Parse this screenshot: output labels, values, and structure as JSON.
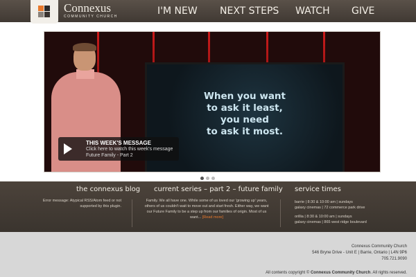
{
  "header": {
    "brand_name": "Connexus",
    "brand_sub": "COMMUNITY CHURCH",
    "logo_colors": [
      "#e8792c",
      "#2b2b2b",
      "#8a837c",
      "#d9d4cd"
    ],
    "nav": [
      "I'M NEW",
      "NEXT STEPS",
      "WATCH",
      "GIVE"
    ]
  },
  "hero": {
    "slide_text": [
      "When you want",
      "to ask it least,",
      "you need",
      "to ask it most."
    ],
    "message_title": "THIS WEEK'S MESSAGE",
    "message_line1": "Click here to watch this week's message",
    "message_line2": "Future Family - Part 2",
    "play_icon": "play-icon",
    "carousel_dots": 3,
    "active_dot": 1
  },
  "blog": {
    "title": "the connexus blog",
    "text_line1": "Error message: Atypical RSS/Atom feed or not",
    "text_line2": "supported by this plugin."
  },
  "series": {
    "title": "current series – part 2 – future family",
    "lines": [
      "Family. We all have one. While some of us loved our 'growing up' years,",
      "others of us couldn't wait to move out and start fresh. Either way, we want",
      "our Future Family to be a step up from our families of origin. Most of us"
    ],
    "last_line": "want...",
    "read_more": "[Read more]"
  },
  "service_times": {
    "title": "service times",
    "lines": [
      "barrie | 8:30 & 10:00 am | sundays",
      "galaxy cinemas | 72 commerce park drive",
      "orillia | 8:30 & 10:00 am | sundays",
      "galaxy cinemas | 865 west ridge boulevard"
    ]
  },
  "footer": {
    "org": "Connexus Community Church",
    "address": "546 Bryne Drive - Unit E | Barrie, Ontario | L4N 9P6",
    "phone": "705.721.9090",
    "copyright_prefix": "All contents copyright ©",
    "copyright_org": "Connexus Community Church",
    "copyright_suffix": ". All rights reserved."
  },
  "colors": {
    "header_bg": "#4b433c",
    "accent": "#e8792c",
    "band_bg": "#433b34",
    "footer_bg": "#d7d7d7"
  }
}
